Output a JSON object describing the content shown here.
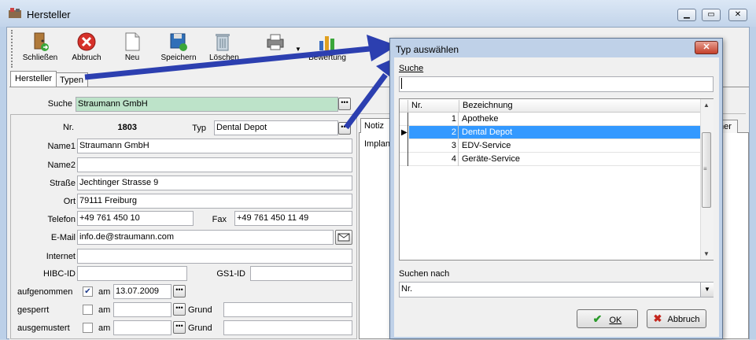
{
  "window": {
    "title": "Hersteller"
  },
  "toolbar": {
    "close_label": "Schließen",
    "cancel_label": "Abbruch",
    "new_label": "Neu",
    "save_label": "Speichern",
    "delete_label": "Löschen",
    "print_label": "",
    "rating_label": "Bewertung"
  },
  "tabs": [
    {
      "label": "Hersteller"
    },
    {
      "label": "Typen"
    }
  ],
  "form": {
    "search_label": "Suche",
    "search_value": "Straumann GmbH",
    "nr_label": "Nr.",
    "nr_value": "1803",
    "typ_label": "Typ",
    "typ_value": "Dental Depot",
    "name1_label": "Name1",
    "name1_value": "Straumann GmbH",
    "name2_label": "Name2",
    "name2_value": "",
    "street_label": "Straße",
    "street_value": "Jechtinger Strasse 9",
    "city_label": "Ort",
    "city_value": "79111 Freiburg",
    "phone_label": "Telefon",
    "phone_value": "+49 761 450 10",
    "fax_label": "Fax",
    "fax_value": "+49 761 450 11 49",
    "email_label": "E-Mail",
    "email_value": "info.de@straumann.com",
    "internet_label": "Internet",
    "internet_value": "",
    "hibc_label": "HIBC-ID",
    "hibc_value": "",
    "gs1_label": "GS1-ID",
    "gs1_value": "",
    "accepted_label": "aufgenommen",
    "accepted_checked": true,
    "accepted_am": "am",
    "accepted_date": "13.07.2009",
    "blocked_label": "gesperrt",
    "blocked_am": "am",
    "blocked_grund": "Grund",
    "retired_label": "ausgemustert",
    "retired_am": "am",
    "retired_grund": "Grund",
    "notes_tab": "Notiz",
    "notes_text": "Implan",
    "right_tab_partial": "ner"
  },
  "dialog": {
    "title": "Typ auswählen",
    "search_label": "Suche",
    "search_value": "",
    "columns": [
      "Nr.",
      "Bezeichnung"
    ],
    "rows": [
      {
        "nr": "1",
        "name": "Apotheke"
      },
      {
        "nr": "2",
        "name": "Dental Depot"
      },
      {
        "nr": "3",
        "name": "EDV-Service"
      },
      {
        "nr": "4",
        "name": "Geräte-Service"
      }
    ],
    "selected_index": 1,
    "search_by_label": "Suchen nach",
    "search_by_value": "Nr.",
    "ok_label": "OK",
    "cancel_label": "Abbruch"
  },
  "colors": {
    "selection": "#3399ff",
    "search_field_bg": "#bde3c9",
    "arrow": "#2c3fb0"
  }
}
